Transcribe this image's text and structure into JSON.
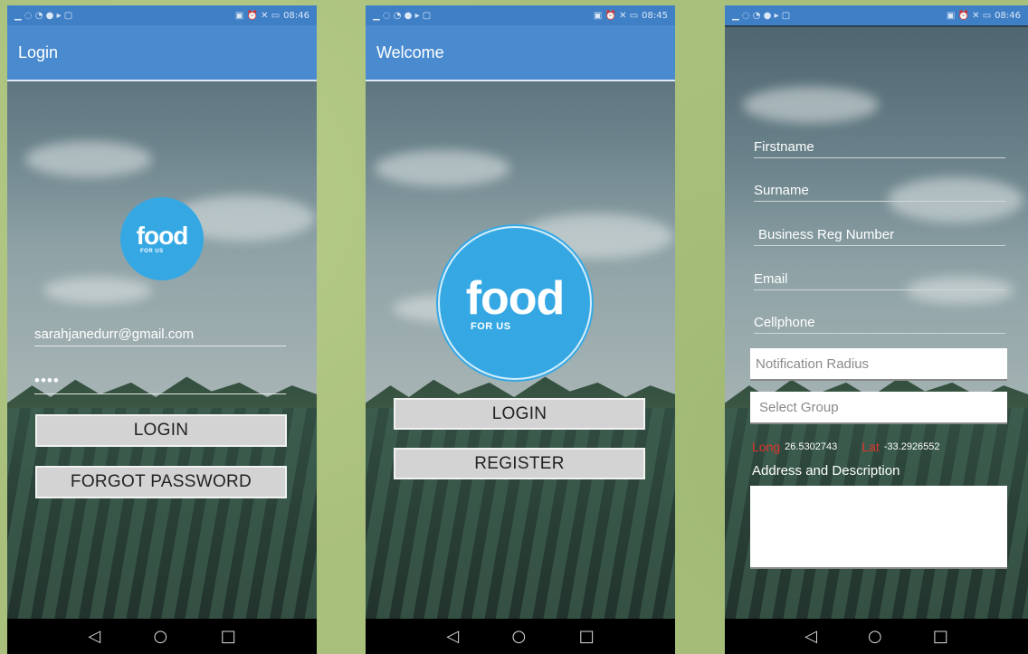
{
  "status": {
    "left_icons": "▁ ◌ ◔ ● ▸ ▢",
    "right_icons": "▣ ⏰ ✕ ▭",
    "time_login": "08:46",
    "time_welcome": "08:45",
    "time_register": "08:46"
  },
  "colors": {
    "appbar": "#4a8bd0",
    "logo": "#35a8e4",
    "button": "#d3d3d3",
    "coord_label": "#e0332d"
  },
  "nav": {
    "back": "◁",
    "home": "○",
    "recent": "□"
  },
  "login_screen": {
    "title": "Login",
    "logo_word": "food",
    "logo_sub": "FOR US",
    "email_value": "sarahjanedurr@gmail.com",
    "password_value": "••••",
    "login_button": "LOGIN",
    "forgot_button": "FORGOT PASSWORD"
  },
  "welcome_screen": {
    "title": "Welcome",
    "logo_word": "food",
    "logo_sub": "FOR US",
    "login_button": "LOGIN",
    "register_button": "REGISTER"
  },
  "register_screen": {
    "firstname": "Firstname",
    "surname": "Surname",
    "business_reg": "Business Reg Number",
    "email": "Email",
    "cellphone": "Cellphone",
    "notification_radius": "Notification Radius",
    "select_group": "Select Group",
    "long_label": "Long",
    "long_value": "26.5302743",
    "lat_label": "Lat",
    "lat_value": "-33.2926552",
    "address_label": "Address and Description"
  }
}
